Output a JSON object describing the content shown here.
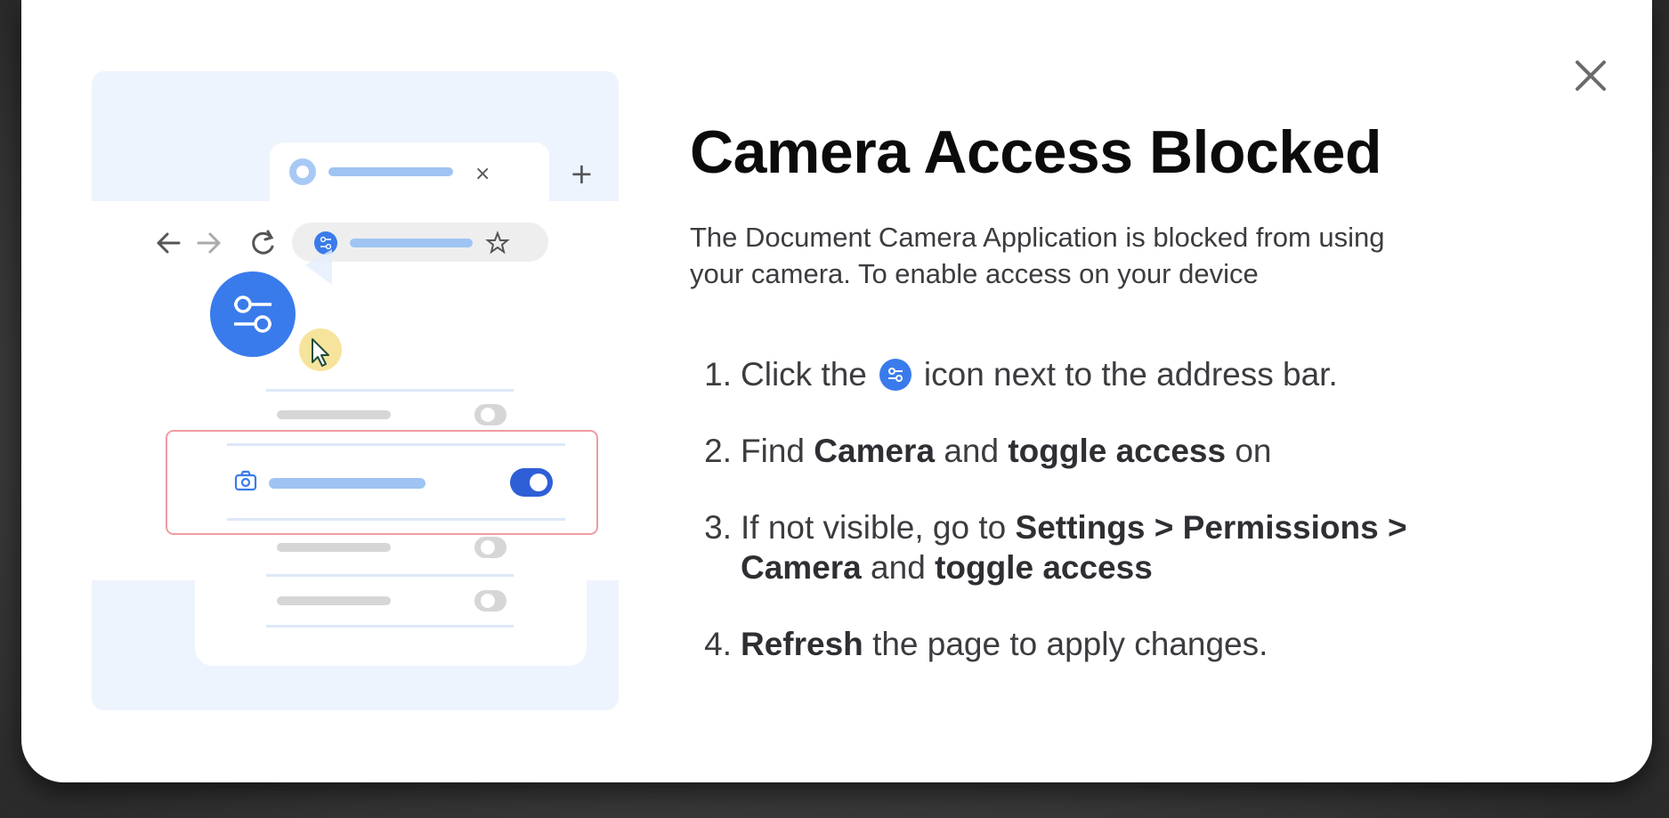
{
  "dialog": {
    "title": "Camera Access Blocked",
    "subtitle": "The Document Camera Application is blocked from using your camera. To enable access on your device",
    "steps": [
      {
        "num": "1.",
        "pre": "Click the",
        "icon": "site-settings-icon",
        "post": "icon next to the address bar."
      },
      {
        "num": "2.",
        "pre": "Find",
        "bold1": "Camera",
        "mid": "and",
        "bold2": "toggle access",
        "post": "on"
      },
      {
        "num": "3.",
        "pre": "If not visible, go to",
        "bold1": "Settings >  Permissions >",
        "bold1b": "Camera",
        "mid": "and",
        "bold2": "toggle access"
      },
      {
        "num": "4.",
        "bold1": "Refresh",
        "post": "the page to apply changes."
      }
    ],
    "close_icon": "close-icon"
  },
  "illustration": {
    "tab_close_glyph": "×",
    "new_tab_glyph": "+"
  },
  "colors": {
    "accent": "#3a7bec",
    "light_blue": "#9fc4f3",
    "highlight_border": "#f29aa0",
    "cursor_bg": "#f7e49c"
  }
}
